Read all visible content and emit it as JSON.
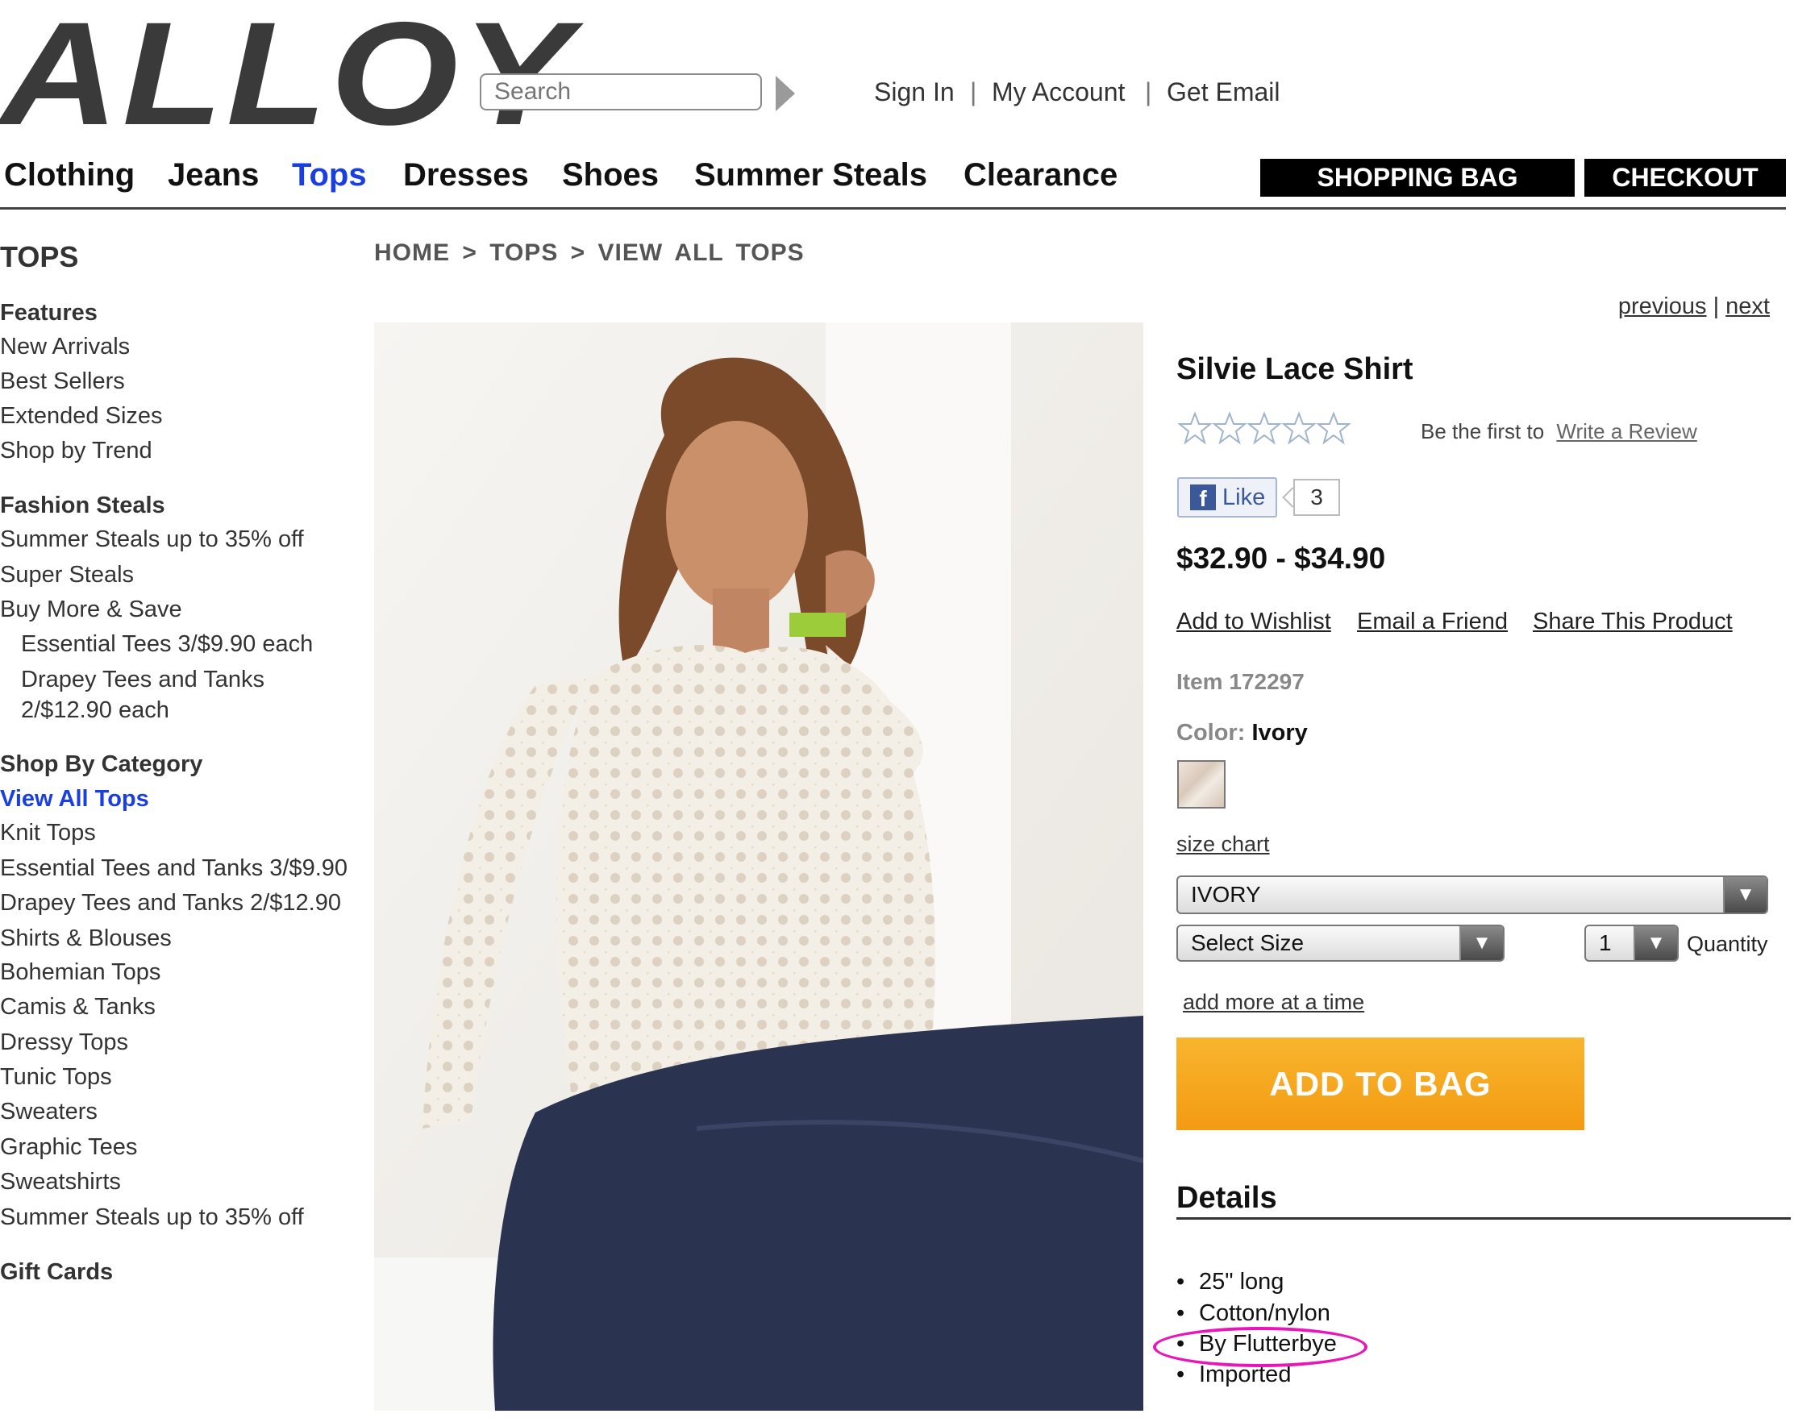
{
  "header": {
    "logo": "ALLOY",
    "search_placeholder": "Search",
    "links": [
      "Sign In",
      "My Account",
      "Get Email"
    ],
    "separator": "|"
  },
  "nav": {
    "items": [
      "Clothing",
      "Jeans",
      "Tops",
      "Dresses",
      "Shoes",
      "Summer Steals",
      "Clearance"
    ],
    "active": "Tops",
    "shopping_bag": "SHOPPING BAG",
    "checkout": "CHECKOUT"
  },
  "sidebar": {
    "heading": "TOPS",
    "features_heading": "Features",
    "features": [
      "New Arrivals",
      "Best Sellers",
      "Extended Sizes",
      "Shop by Trend"
    ],
    "fashion_heading": "Fashion Steals",
    "fashion": [
      "Summer Steals up to 35% off",
      "Super Steals",
      "Buy More & Save"
    ],
    "fashion_sub": [
      "Essential Tees 3/$9.90 each",
      "Drapey Tees and Tanks",
      "2/$12.90 each"
    ],
    "category_heading": "Shop By Category",
    "categories": [
      "View All Tops",
      "Knit Tops",
      "Essential Tees and Tanks 3/$9.90",
      "Drapey Tees and Tanks 2/$12.90",
      "Shirts & Blouses",
      "Bohemian Tops",
      "Camis & Tanks",
      "Dressy Tops",
      "Tunic Tops",
      "Sweaters",
      "Graphic Tees",
      "Sweatshirts",
      "Summer Steals up to 35% off"
    ],
    "gift_cards": "Gift Cards"
  },
  "breadcrumb": "HOME > TOPS > VIEW ALL TOPS",
  "pager": {
    "previous": "previous",
    "separator": "|",
    "next": "next"
  },
  "product": {
    "title": "Silvie Lace Shirt",
    "rating_stars": 0,
    "review_prompt": "Be the first to",
    "review_link": "Write a Review",
    "like_label": "Like",
    "like_count": "3",
    "price": "$32.90 - $34.90",
    "actions": [
      "Add to Wishlist",
      "Email a Friend",
      "Share This Product"
    ],
    "item": "Item 172297",
    "color_label": "Color:",
    "color_value": "Ivory",
    "size_chart": "size chart",
    "color_select": "IVORY",
    "size_select": "Select Size",
    "quantity_value": "1",
    "quantity_label": "Quantity",
    "add_more": "add more at a time",
    "add_to_bag": "ADD TO BAG",
    "details_heading": "Details",
    "details": [
      "25\" long",
      "Cotton/nylon",
      "By Flutterbye",
      "Imported"
    ]
  },
  "colors": {
    "link_active": "#1a3fe0",
    "add_to_bag": "#f5a623",
    "highlight": "#e815b8"
  }
}
